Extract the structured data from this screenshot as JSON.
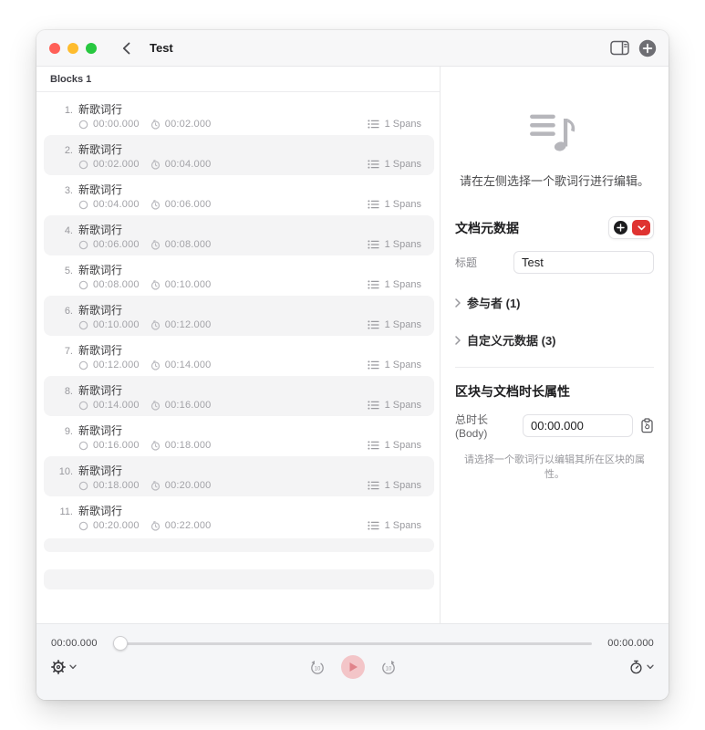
{
  "titlebar": {
    "title": "Test"
  },
  "blocks": {
    "header": "Blocks 1"
  },
  "rows": [
    {
      "num": "1.",
      "title": "新歌词行",
      "start": "00:00.000",
      "end": "00:02.000",
      "spans": "1 Spans"
    },
    {
      "num": "2.",
      "title": "新歌词行",
      "start": "00:02.000",
      "end": "00:04.000",
      "spans": "1 Spans"
    },
    {
      "num": "3.",
      "title": "新歌词行",
      "start": "00:04.000",
      "end": "00:06.000",
      "spans": "1 Spans"
    },
    {
      "num": "4.",
      "title": "新歌词行",
      "start": "00:06.000",
      "end": "00:08.000",
      "spans": "1 Spans"
    },
    {
      "num": "5.",
      "title": "新歌词行",
      "start": "00:08.000",
      "end": "00:10.000",
      "spans": "1 Spans"
    },
    {
      "num": "6.",
      "title": "新歌词行",
      "start": "00:10.000",
      "end": "00:12.000",
      "spans": "1 Spans"
    },
    {
      "num": "7.",
      "title": "新歌词行",
      "start": "00:12.000",
      "end": "00:14.000",
      "spans": "1 Spans"
    },
    {
      "num": "8.",
      "title": "新歌词行",
      "start": "00:14.000",
      "end": "00:16.000",
      "spans": "1 Spans"
    },
    {
      "num": "9.",
      "title": "新歌词行",
      "start": "00:16.000",
      "end": "00:18.000",
      "spans": "1 Spans"
    },
    {
      "num": "10.",
      "title": "新歌词行",
      "start": "00:18.000",
      "end": "00:20.000",
      "spans": "1 Spans"
    },
    {
      "num": "11.",
      "title": "新歌词行",
      "start": "00:20.000",
      "end": "00:22.000",
      "spans": "1 Spans"
    }
  ],
  "inspector": {
    "empty_hint": "请在左侧选择一个歌词行进行编辑。",
    "metadata": {
      "heading": "文档元数据",
      "title_label": "标题",
      "title_value": "Test",
      "participants_label": "参与者 (1)",
      "custom_label": "自定义元数据 (3)"
    },
    "duration": {
      "heading": "区块与文档时长属性",
      "total_label": "总时长 (Body)",
      "total_value": "00:00.000",
      "hint": "请选择一个歌词行以编辑其所在区块的属性。"
    }
  },
  "player": {
    "current": "00:00.000",
    "total": "00:00.000",
    "skip_back_label": "10",
    "skip_forward_label": "10"
  },
  "colors": {
    "accent_red": "#df3331",
    "traffic_red": "#ff5f57",
    "traffic_yellow": "#febc2e",
    "traffic_green": "#28c840",
    "play_bg": "#f3c5c8",
    "play_icon": "#e0838a",
    "row_stripe": "#f4f4f5"
  }
}
